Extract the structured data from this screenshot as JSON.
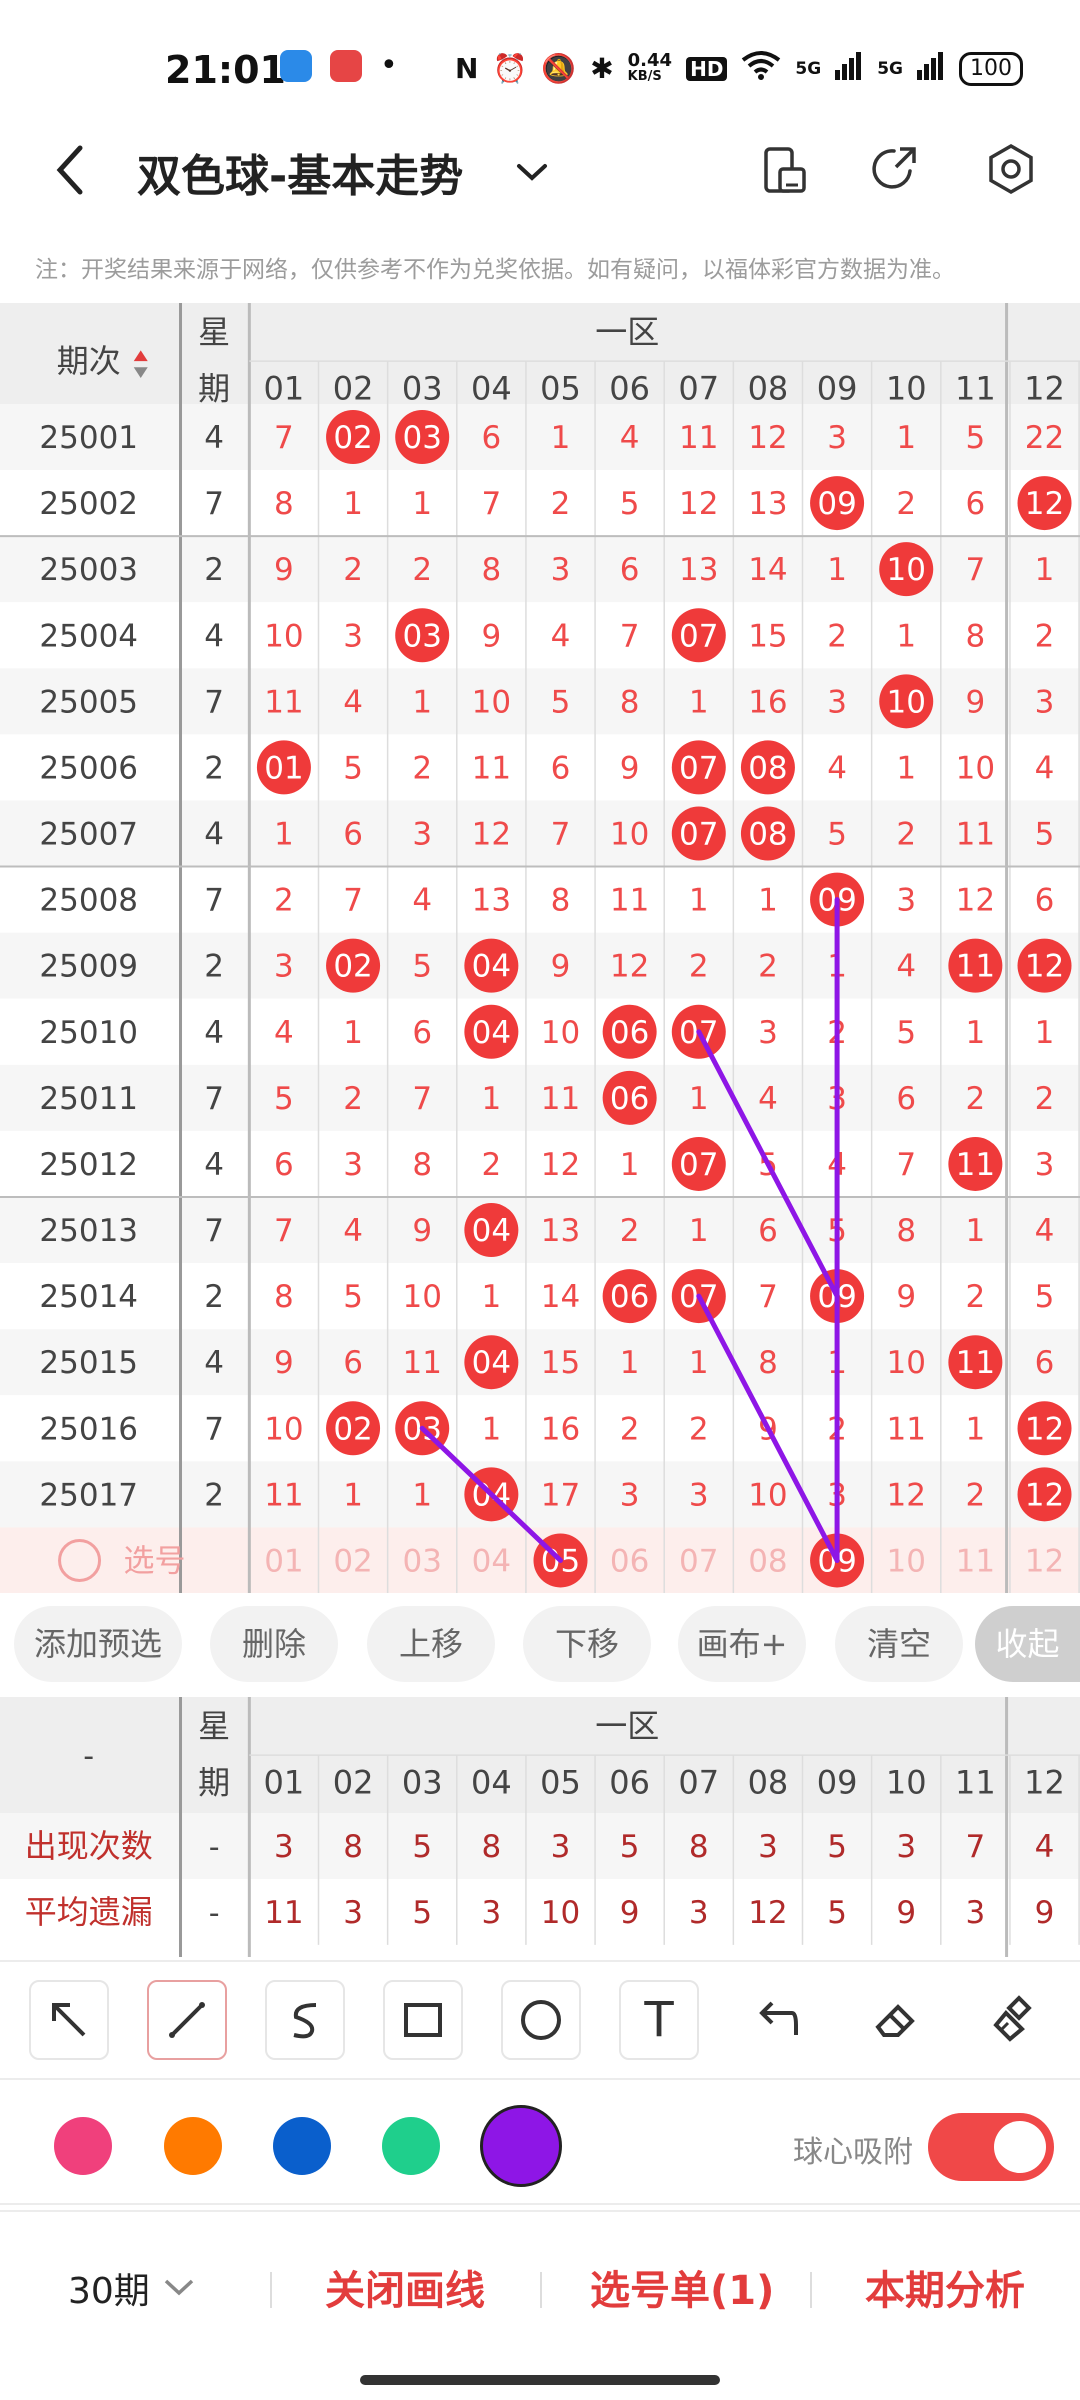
{
  "status_bar": {
    "time": "21:01",
    "speed": "0.44",
    "speed_unit": "KB/S",
    "hd": "HD",
    "net1": "5G",
    "net2": "5G",
    "battery": "100"
  },
  "header": {
    "title": "双色球-基本走势"
  },
  "notice": "注：开奖结果来源于网络，仅供参考不作为兑奖依据。如有疑问，以福体彩官方数据为准。",
  "table": {
    "col_period": "期次",
    "col_week_line1": "星",
    "col_week_line2": "期",
    "zone_label": "一区",
    "numbers": [
      "01",
      "02",
      "03",
      "04",
      "05",
      "06",
      "07",
      "08",
      "09",
      "10",
      "11",
      "12"
    ],
    "rows": [
      {
        "period": "25001",
        "week": "4",
        "cells": [
          "7",
          "02",
          "03",
          "6",
          "1",
          "4",
          "11",
          "12",
          "3",
          "1",
          "5",
          "22"
        ],
        "hits": [
          1,
          2
        ]
      },
      {
        "period": "25002",
        "week": "7",
        "cells": [
          "8",
          "1",
          "1",
          "7",
          "2",
          "5",
          "12",
          "13",
          "09",
          "2",
          "6",
          "12"
        ],
        "hits": [
          8,
          11
        ]
      },
      {
        "period": "25003",
        "week": "2",
        "cells": [
          "9",
          "2",
          "2",
          "8",
          "3",
          "6",
          "13",
          "14",
          "1",
          "10",
          "7",
          "1"
        ],
        "hits": [
          9
        ]
      },
      {
        "period": "25004",
        "week": "4",
        "cells": [
          "10",
          "3",
          "03",
          "9",
          "4",
          "7",
          "07",
          "15",
          "2",
          "1",
          "8",
          "2"
        ],
        "hits": [
          2,
          6
        ]
      },
      {
        "period": "25005",
        "week": "7",
        "cells": [
          "11",
          "4",
          "1",
          "10",
          "5",
          "8",
          "1",
          "16",
          "3",
          "10",
          "9",
          "3"
        ],
        "hits": [
          9
        ]
      },
      {
        "period": "25006",
        "week": "2",
        "cells": [
          "01",
          "5",
          "2",
          "11",
          "6",
          "9",
          "07",
          "08",
          "4",
          "1",
          "10",
          "4"
        ],
        "hits": [
          0,
          6,
          7
        ]
      },
      {
        "period": "25007",
        "week": "4",
        "cells": [
          "1",
          "6",
          "3",
          "12",
          "7",
          "10",
          "07",
          "08",
          "5",
          "2",
          "11",
          "5"
        ],
        "hits": [
          6,
          7
        ]
      },
      {
        "period": "25008",
        "week": "7",
        "cells": [
          "2",
          "7",
          "4",
          "13",
          "8",
          "11",
          "1",
          "1",
          "09",
          "3",
          "12",
          "6"
        ],
        "hits": [
          8
        ]
      },
      {
        "period": "25009",
        "week": "2",
        "cells": [
          "3",
          "02",
          "5",
          "04",
          "9",
          "12",
          "2",
          "2",
          "1",
          "4",
          "11",
          "12"
        ],
        "hits": [
          1,
          3,
          10,
          11
        ]
      },
      {
        "period": "25010",
        "week": "4",
        "cells": [
          "4",
          "1",
          "6",
          "04",
          "10",
          "06",
          "07",
          "3",
          "2",
          "5",
          "1",
          "1"
        ],
        "hits": [
          3,
          5,
          6
        ]
      },
      {
        "period": "25011",
        "week": "7",
        "cells": [
          "5",
          "2",
          "7",
          "1",
          "11",
          "06",
          "1",
          "4",
          "3",
          "6",
          "2",
          "2"
        ],
        "hits": [
          5
        ]
      },
      {
        "period": "25012",
        "week": "4",
        "cells": [
          "6",
          "3",
          "8",
          "2",
          "12",
          "1",
          "07",
          "5",
          "4",
          "7",
          "11",
          "3"
        ],
        "hits": [
          6,
          10
        ]
      },
      {
        "period": "25013",
        "week": "7",
        "cells": [
          "7",
          "4",
          "9",
          "04",
          "13",
          "2",
          "1",
          "6",
          "5",
          "8",
          "1",
          "4"
        ],
        "hits": [
          3
        ]
      },
      {
        "period": "25014",
        "week": "2",
        "cells": [
          "8",
          "5",
          "10",
          "1",
          "14",
          "06",
          "07",
          "7",
          "09",
          "9",
          "2",
          "5"
        ],
        "hits": [
          5,
          6,
          8
        ]
      },
      {
        "period": "25015",
        "week": "4",
        "cells": [
          "9",
          "6",
          "11",
          "04",
          "15",
          "1",
          "1",
          "8",
          "1",
          "10",
          "11",
          "6"
        ],
        "hits": [
          3,
          10
        ]
      },
      {
        "period": "25016",
        "week": "7",
        "cells": [
          "10",
          "02",
          "03",
          "1",
          "16",
          "2",
          "2",
          "9",
          "2",
          "11",
          "1",
          "12"
        ],
        "hits": [
          1,
          2,
          11
        ]
      },
      {
        "period": "25017",
        "week": "2",
        "cells": [
          "11",
          "1",
          "1",
          "04",
          "17",
          "3",
          "3",
          "10",
          "3",
          "12",
          "2",
          "12"
        ],
        "hits": [
          3,
          11
        ]
      }
    ],
    "pick_label": "选号",
    "pick_selected": [
      4,
      8
    ]
  },
  "actions": {
    "add": "添加预选",
    "delete": "删除",
    "up": "上移",
    "down": "下移",
    "canvas": "画布+",
    "clear": "清空",
    "collapse": "收起"
  },
  "stats": {
    "corner": "-",
    "row1_label": "出现次数",
    "row1_week": "-",
    "row1_values": [
      "3",
      "8",
      "5",
      "8",
      "3",
      "5",
      "8",
      "3",
      "5",
      "3",
      "7",
      "4"
    ],
    "row2_label": "平均遗漏",
    "row2_week": "-",
    "row2_values": [
      "11",
      "3",
      "5",
      "3",
      "10",
      "9",
      "3",
      "12",
      "5",
      "9",
      "3",
      "9"
    ]
  },
  "tools": {
    "selected": "line-tool",
    "text_tool_glyph": "T"
  },
  "colors": {
    "pink": "#f0407c",
    "orange": "#ff7a00",
    "blue": "#0a5fcc",
    "green": "#1fcf8c",
    "purple": "#8e16e6",
    "selected": "purple"
  },
  "snap": {
    "label": "球心吸附",
    "enabled": true
  },
  "bottom": {
    "periods": "30期",
    "close_lines": "关闭画线",
    "pick_list": "选号单(1)",
    "analysis": "本期分析"
  }
}
